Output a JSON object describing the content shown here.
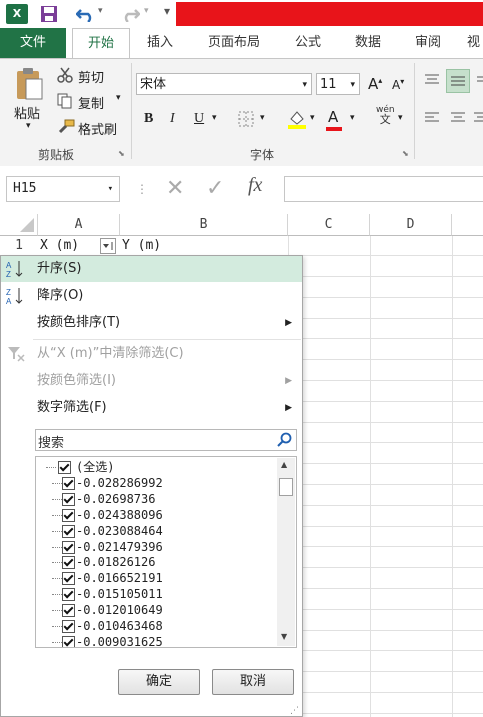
{
  "qat": {
    "logo": "X",
    "logo_sub": "≣",
    "save_icon": "save-icon",
    "undo_icon": "undo-icon",
    "redo_icon": "redo-icon"
  },
  "colors": {
    "brand": "#217346",
    "highlight": "#d3ebde",
    "title_bar": "#e8141a"
  },
  "tabs": [
    {
      "label": "文件"
    },
    {
      "label": "开始"
    },
    {
      "label": "插入"
    },
    {
      "label": "页面布局"
    },
    {
      "label": "公式"
    },
    {
      "label": "数据"
    },
    {
      "label": "审阅"
    },
    {
      "label": "视"
    }
  ],
  "ribbon": {
    "paste": "粘贴",
    "cut": "剪切",
    "copy": "复制",
    "format_painter": "格式刷",
    "clipboard_group": "剪贴板",
    "font_name": "宋体",
    "font_size": "11",
    "grow": "A",
    "shrink": "A",
    "bold": "B",
    "italic": "I",
    "underline": "U",
    "font_color": "A",
    "phonetic_top": "wén",
    "phonetic_bottom": "文",
    "font_group": "字体"
  },
  "formula_bar": {
    "name_box": "H15",
    "cancel": "✕",
    "enter": "✓",
    "fx": "fx",
    "value": ""
  },
  "columns": [
    "A",
    "B",
    "C",
    "D"
  ],
  "row_number": "1",
  "cells": {
    "a1": "X (m)",
    "b1": "Y (m)"
  },
  "filter_menu": {
    "sort_asc": "升序(S)",
    "sort_desc": "降序(O)",
    "sort_by_color": "按颜色排序(T)",
    "clear_filter": "从“X (m)”中清除筛选(C)",
    "filter_by_color": "按颜色筛选(I)",
    "number_filters": "数字筛选(F)",
    "search_placeholder": "搜索",
    "items": [
      "(全选)",
      "-0.028286992",
      "-0.02698736",
      "-0.024388096",
      "-0.023088464",
      "-0.021479396",
      "-0.01826126",
      "-0.016652191",
      "-0.015105011",
      "-0.012010649",
      "-0.010463468",
      "-0.009031625"
    ],
    "ok": "确定",
    "cancel": "取消"
  }
}
